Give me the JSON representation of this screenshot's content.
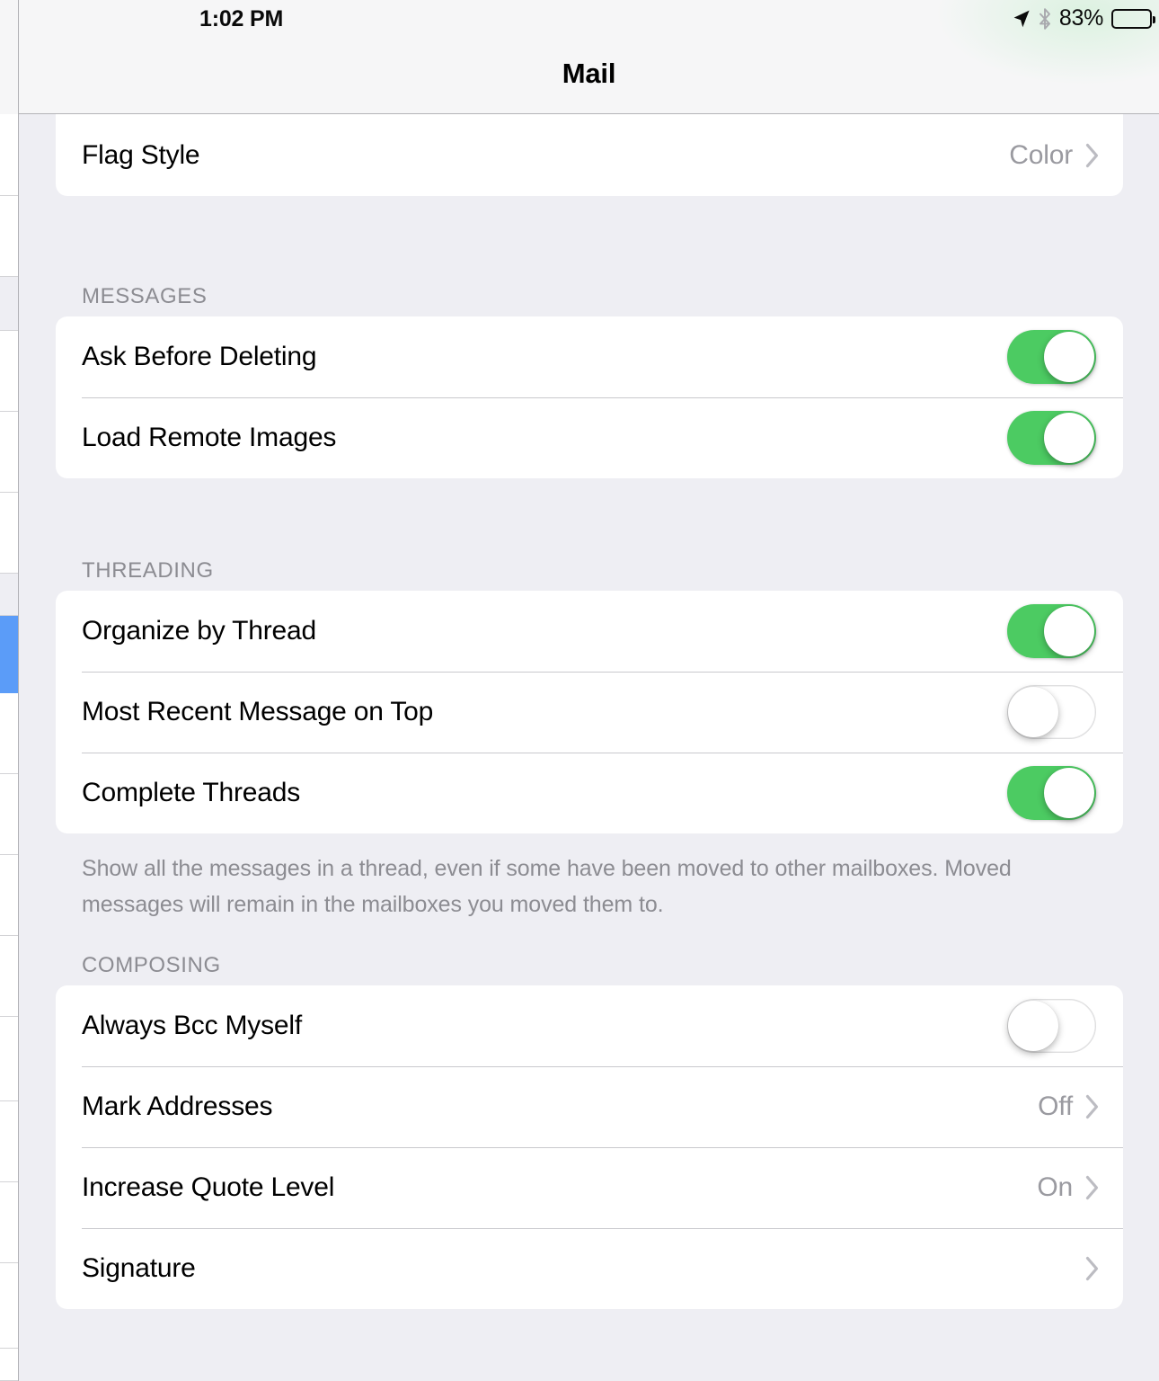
{
  "statusbar": {
    "time": "1:02 PM",
    "battery_percent": "83%",
    "battery_level": 83,
    "location_icon": "location-arrow-icon",
    "bluetooth_icon": "bluetooth-icon",
    "battery_icon": "battery-icon"
  },
  "navbar": {
    "title": "Mail"
  },
  "sections": [
    {
      "header": "",
      "footer": "",
      "rows": [
        {
          "label": "Flag Style",
          "value": "Color",
          "type": "disclosure"
        }
      ]
    },
    {
      "header": "MESSAGES",
      "footer": "",
      "rows": [
        {
          "label": "Ask Before Deleting",
          "value": "",
          "type": "switch",
          "on": true
        },
        {
          "label": "Load Remote Images",
          "value": "",
          "type": "switch",
          "on": true
        }
      ]
    },
    {
      "header": "THREADING",
      "footer": "Show all the messages in a thread, even if some have been moved to other mailboxes. Moved messages will remain in the mailboxes you moved them to.",
      "rows": [
        {
          "label": "Organize by Thread",
          "value": "",
          "type": "switch",
          "on": true
        },
        {
          "label": "Most Recent Message on Top",
          "value": "",
          "type": "switch",
          "on": false
        },
        {
          "label": "Complete Threads",
          "value": "",
          "type": "switch",
          "on": true
        }
      ]
    },
    {
      "header": "COMPOSING",
      "footer": "",
      "rows": [
        {
          "label": "Always Bcc Myself",
          "value": "",
          "type": "switch",
          "on": false
        },
        {
          "label": "Mark Addresses",
          "value": "Off",
          "type": "disclosure"
        },
        {
          "label": "Increase Quote Level",
          "value": "On",
          "type": "disclosure"
        },
        {
          "label": "Signature",
          "value": "",
          "type": "disclosure"
        }
      ]
    }
  ],
  "colors": {
    "switch_on": "#4ccb62",
    "selected_row": "#5b9cf8",
    "page_background": "#eeeef3",
    "card_background": "#ffffff",
    "secondary_text": "#8c8c92"
  }
}
